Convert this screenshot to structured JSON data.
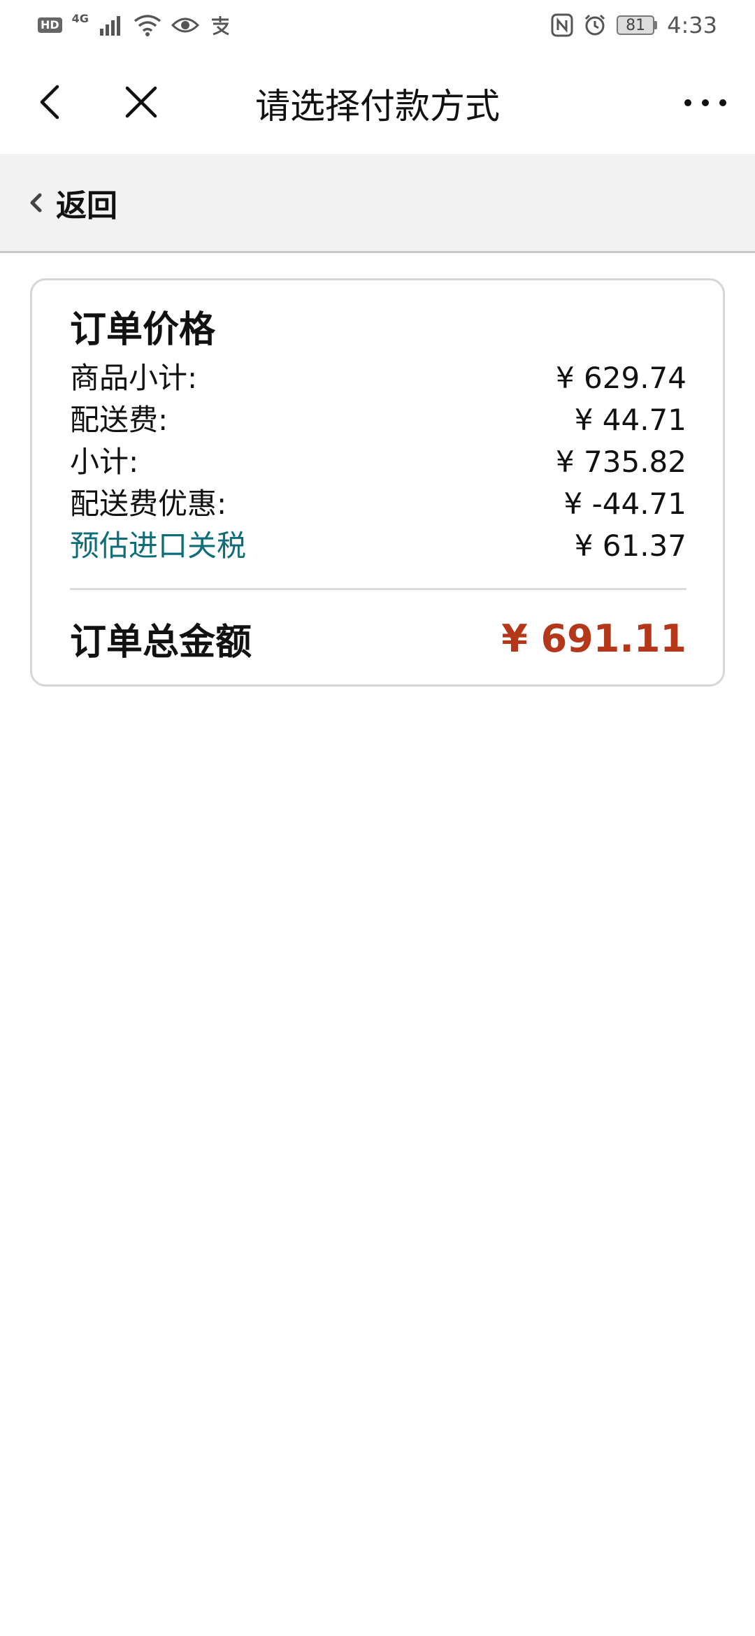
{
  "status_bar": {
    "hd": "HD",
    "network": "4G",
    "battery": "81",
    "time": "4:33",
    "icons": [
      "signal-icon",
      "wifi-icon",
      "eye-icon",
      "alipay-icon",
      "nfc-icon",
      "alarm-icon",
      "battery-icon"
    ]
  },
  "header": {
    "title": "请选择付款方式",
    "icons": [
      "chevron-left-icon",
      "close-icon",
      "more-icon"
    ]
  },
  "back_bar": {
    "label": "返回"
  },
  "order": {
    "title": "订单价格",
    "rows": [
      {
        "label": "商品小计:",
        "value": "¥ 629.74"
      },
      {
        "label": "配送费:",
        "value": "¥ 44.71"
      },
      {
        "label": "小计:",
        "value": "¥ 735.82"
      },
      {
        "label": "配送费优惠:",
        "value": "¥ -44.71"
      },
      {
        "label": "预估进口关税",
        "value": "¥ 61.37"
      }
    ],
    "total_label": "订单总金额",
    "total_value": "¥ 691.11"
  },
  "colors": {
    "link": "#0d6e7a",
    "total": "#b5371a",
    "back_bar_bg": "#f2f2f2"
  }
}
